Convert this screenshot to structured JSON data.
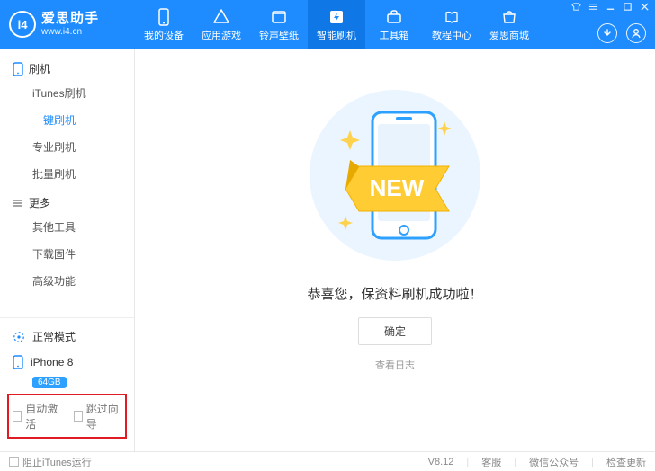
{
  "brand": {
    "logo_text": "i4",
    "name": "爱思助手",
    "url": "www.i4.cn"
  },
  "nav": {
    "items": [
      {
        "key": "my-device",
        "label": "我的设备"
      },
      {
        "key": "app-games",
        "label": "应用游戏"
      },
      {
        "key": "ring-wall",
        "label": "铃声壁纸"
      },
      {
        "key": "smart-flash",
        "label": "智能刷机"
      },
      {
        "key": "toolbox",
        "label": "工具箱"
      },
      {
        "key": "tutorial",
        "label": "教程中心"
      },
      {
        "key": "store",
        "label": "爱思商城"
      }
    ],
    "active": 3
  },
  "sidebar": {
    "groups": [
      {
        "key": "flash",
        "label": "刷机",
        "items": [
          {
            "key": "itunes-flash",
            "label": "iTunes刷机"
          },
          {
            "key": "one-click-flash",
            "label": "一键刷机"
          },
          {
            "key": "pro-flash",
            "label": "专业刷机"
          },
          {
            "key": "batch-flash",
            "label": "批量刷机"
          }
        ],
        "activeIndex": 1
      },
      {
        "key": "more",
        "label": "更多",
        "items": [
          {
            "key": "other-tools",
            "label": "其他工具"
          },
          {
            "key": "download-fw",
            "label": "下载固件"
          },
          {
            "key": "advanced",
            "label": "高级功能"
          }
        ]
      }
    ],
    "mode_label": "正常模式",
    "device": {
      "name": "iPhone 8",
      "storage": "64GB"
    },
    "options": {
      "auto_activate": "自动激活",
      "skip_setup": "跳过向导"
    }
  },
  "content": {
    "badge": "NEW",
    "success_message": "恭喜您，保资料刷机成功啦！",
    "confirm": "确定",
    "view_log": "查看日志"
  },
  "statusbar": {
    "block_itunes": "阻止iTunes运行",
    "version": "V8.12",
    "support": "客服",
    "wechat": "微信公众号",
    "update": "检查更新"
  }
}
